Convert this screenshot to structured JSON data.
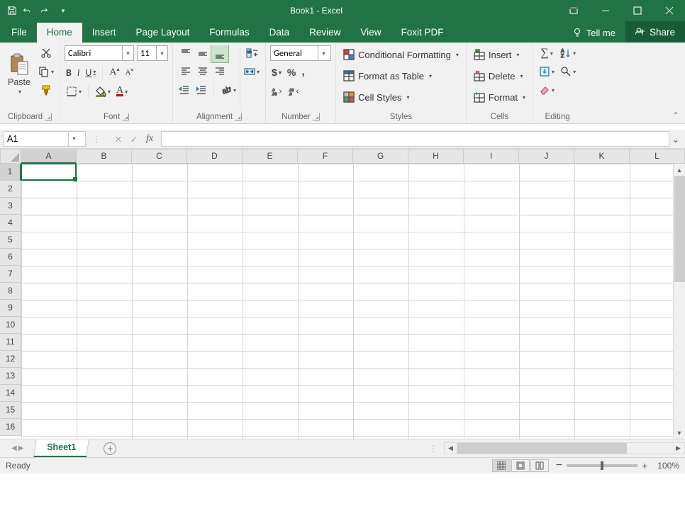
{
  "window": {
    "title": "Book1  -  Excel"
  },
  "tabs": {
    "file": "File",
    "list": [
      "Home",
      "Insert",
      "Page Layout",
      "Formulas",
      "Data",
      "Review",
      "View",
      "Foxit PDF"
    ],
    "active": "Home",
    "tellme": "Tell me",
    "share": "Share"
  },
  "ribbon": {
    "clipboard": {
      "paste": "Paste",
      "label": "Clipboard"
    },
    "font": {
      "name": "Calibri",
      "size": "11",
      "bold": "B",
      "italic": "I",
      "underline": "U",
      "incr": "A",
      "decr": "A",
      "label": "Font"
    },
    "alignment": {
      "label": "Alignment"
    },
    "number": {
      "format": "General",
      "label": "Number"
    },
    "styles": {
      "cond": "Conditional Formatting",
      "table": "Format as Table",
      "cell": "Cell Styles",
      "label": "Styles"
    },
    "cells": {
      "insert": "Insert",
      "delete": "Delete",
      "format": "Format",
      "label": "Cells"
    },
    "editing": {
      "label": "Editing"
    }
  },
  "fbar": {
    "name": "A1",
    "formula": ""
  },
  "grid": {
    "cols": [
      "A",
      "B",
      "C",
      "D",
      "E",
      "F",
      "G",
      "H",
      "I",
      "J",
      "K",
      "L"
    ],
    "rows": [
      "1",
      "2",
      "3",
      "4",
      "5",
      "6",
      "7",
      "8",
      "9",
      "10",
      "11",
      "12",
      "13",
      "14",
      "15",
      "16"
    ]
  },
  "sheettabs": {
    "active": "Sheet1"
  },
  "status": {
    "ready": "Ready",
    "zoom": "100%"
  }
}
